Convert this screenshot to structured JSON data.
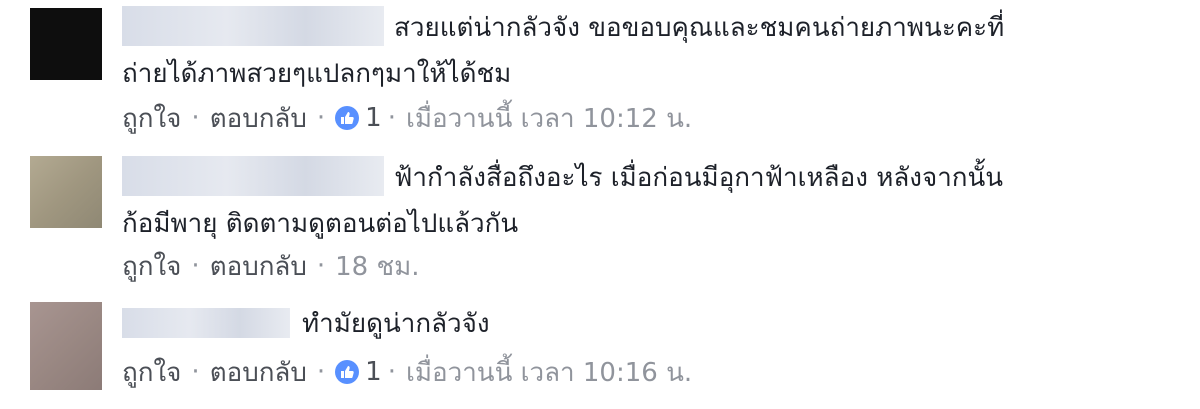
{
  "comments": [
    {
      "text_line1": "สวยแต่น่ากลัวจัง ขอขอบคุณและชมคนถ่ายภาพนะคะที่",
      "text_line2": "ถ่ายได้ภาพสวยๆแปลกๆมาให้ได้ชม",
      "like_label": "ถูกใจ",
      "reply_label": "ตอบกลับ",
      "reaction_count": "1",
      "timestamp": "เมื่อวานนี้ เวลา 10:12 น.",
      "avatar_color": "#111111"
    },
    {
      "text_line1": "ฟ้ากำลังสื่อถึงอะไร เมื่อก่อนมีอุกาฟ้าเหลือง หลังจากนั้น",
      "text_line2": "ก้อมีพายุ ติดตามดูตอนต่อไปแล้วกัน",
      "like_label": "ถูกใจ",
      "reply_label": "ตอบกลับ",
      "timestamp": "18 ชม.",
      "avatar_color": "#a89f86"
    },
    {
      "text_line1": "ทำมัยดูน่ากลัวจัง",
      "like_label": "ถูกใจ",
      "reply_label": "ตอบกลับ",
      "reaction_count": "1",
      "timestamp": "เมื่อวานนี้ เวลา 10:16 น.",
      "avatar_color": "#9d8a86"
    }
  ],
  "icons": {
    "reaction": "thumbs-up-icon"
  },
  "colors": {
    "link_gray": "#4b4f56",
    "meta_gray": "#90949c",
    "like_blue": "#5890ff"
  }
}
